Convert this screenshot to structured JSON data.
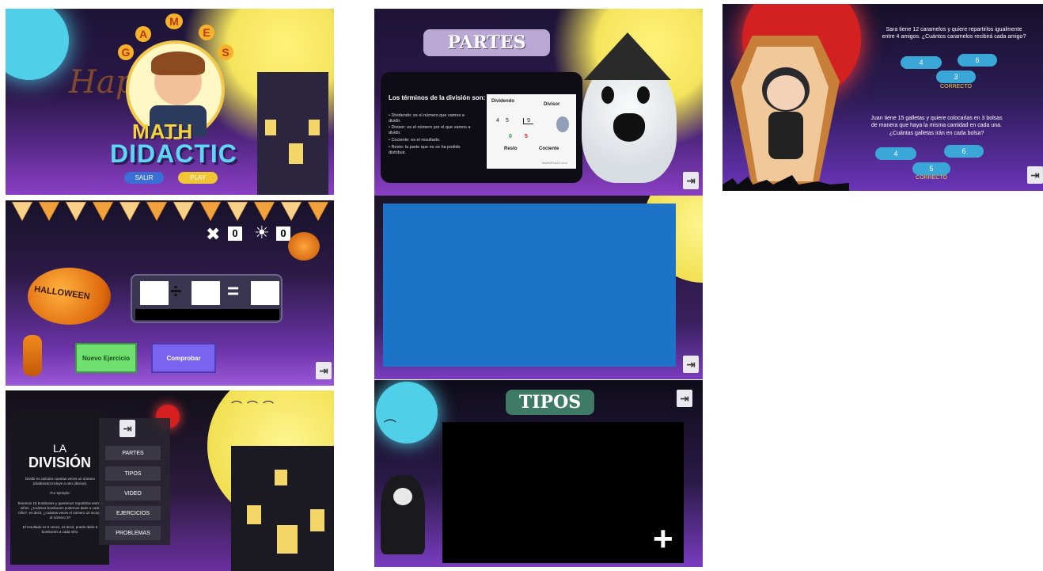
{
  "panels": {
    "title": {
      "letters": [
        "G",
        "A",
        "M",
        "E",
        "S"
      ],
      "logo_math": "MATH",
      "logo_didactic": "DIDACTIC",
      "exit_button": "SALIR",
      "play_button": "PLAY",
      "hw_word": "Happy"
    },
    "calculator": {
      "wrong_count": "0",
      "right_count": "0",
      "pumpkin_text": "HALLOWEEN",
      "new_exercise_button": "Nuevo Ejercicio",
      "check_button": "Comprobar",
      "operator_div": "÷",
      "operator_eq": "="
    },
    "menu": {
      "title_la": "LA",
      "title_division": "DIVISIÓN",
      "desc": "Dividir es calcular cuantas veces un número (dividendo) incluye a otro (divisor).",
      "example_label": "Por ejemplo:",
      "example_text": "Tenemos 15 bombones y queremos repartirlos entre 3 niños. ¿Cuántos bombones podemos darle a cada niño?, es decir, ¿cuántas veces el número 15 incluye al número 3?",
      "result_text": "El resultado es 5 veces, es decir, puedo darle 5 bombones a cada niño.",
      "items": [
        "PARTES",
        "TIPOS",
        "VIDEO",
        "EJERCICIOS",
        "PROBLEMAS"
      ]
    },
    "partes": {
      "title": "PARTES",
      "heading": "Los términos de la división son:",
      "bullets": [
        "• Dividendo: es el número que vamos a dividir.",
        "• Divisor: es el número por el que vamos a dividir.",
        "• Cociente: es el resultado.",
        "• Resto: la parte que no se ha podido distribuir."
      ],
      "diagram": {
        "dividendo": "Dividendo",
        "divisor": "Divisor",
        "resto": "Resto",
        "cociente": "Cociente",
        "num_4": "4",
        "num_5": "5",
        "num_9": "9",
        "num_0": "0",
        "num_5b": "5",
        "credit": "MathsPlus10.com"
      }
    },
    "tipos": {
      "title": "TIPOS"
    },
    "problems": {
      "q1": "Sara tiene 12 caramelos y quiere repartirlos igualmente entre 4 amigos. ¿Cuántos caramelos recibirá cada amigo?",
      "q1_opts": [
        "4",
        "6",
        "3"
      ],
      "q1_status": "CORRECTO",
      "q2": "Juan tiene 15 galletas y quiere colocarlas en 3 bolsas de manera que haya la misma cantidad en cada una. ¿Cuántas galletas irán en cada bolsa?",
      "q2_opts": [
        "4",
        "6",
        "5"
      ],
      "q2_status": "CORRECTO"
    }
  },
  "colors": {
    "pill_blue": "#3aa7d8",
    "correct_yellow": "#f0d23a",
    "video_blue": "#1d73c8",
    "new_btn_green": "#6fe06f",
    "check_btn_purple": "#7a63ee"
  }
}
